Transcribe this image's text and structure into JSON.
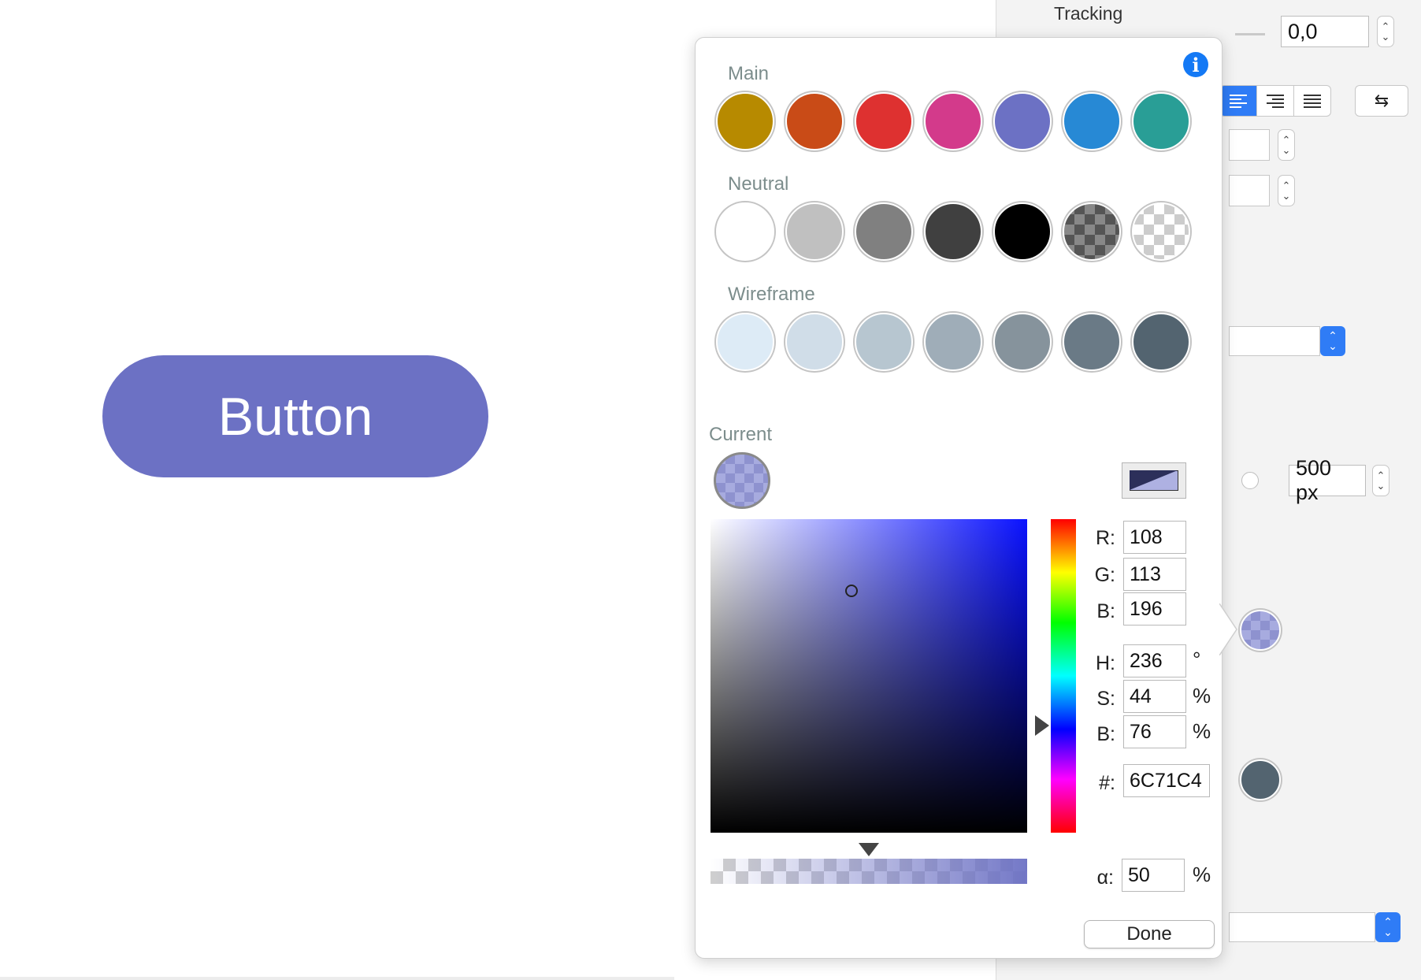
{
  "canvas": {
    "button_label": "Button"
  },
  "inspector": {
    "tracking_label": "Tracking",
    "tracking_value": "0,0",
    "width_value": "500 px"
  },
  "popover": {
    "sections": {
      "main": "Main",
      "neutral": "Neutral",
      "wireframe": "Wireframe",
      "current": "Current"
    },
    "main_colors": [
      "#b78a00",
      "#c94b17",
      "#de3130",
      "#d33a8b",
      "#6c71c4",
      "#2789d5",
      "#299e96"
    ],
    "neutral_colors": [
      "#ffffff",
      "#c0c0c0",
      "#808080",
      "#404040",
      "#000000",
      "checker-dark",
      "checker-light"
    ],
    "wireframe_colors": [
      "#ddebf6",
      "#d0dde8",
      "#b7c6d0",
      "#9fadb8",
      "#86939c",
      "#6a7a86",
      "#536470"
    ],
    "rgb": {
      "r_label": "R:",
      "r": "108",
      "g_label": "G:",
      "g": "113",
      "b_label": "B:",
      "b": "196"
    },
    "hsb": {
      "h_label": "H:",
      "h": "236",
      "h_unit": "°",
      "s_label": "S:",
      "s": "44",
      "s_unit": "%",
      "b_label": "B:",
      "b": "76",
      "b_unit": "%"
    },
    "hex": {
      "label": "#:",
      "value": "6C71C4"
    },
    "alpha": {
      "label": "α:",
      "value": "50",
      "unit": "%"
    },
    "done_label": "Done",
    "info_icon": "info-icon",
    "current_color": "#6c71c4",
    "current_alpha": 0.5
  }
}
